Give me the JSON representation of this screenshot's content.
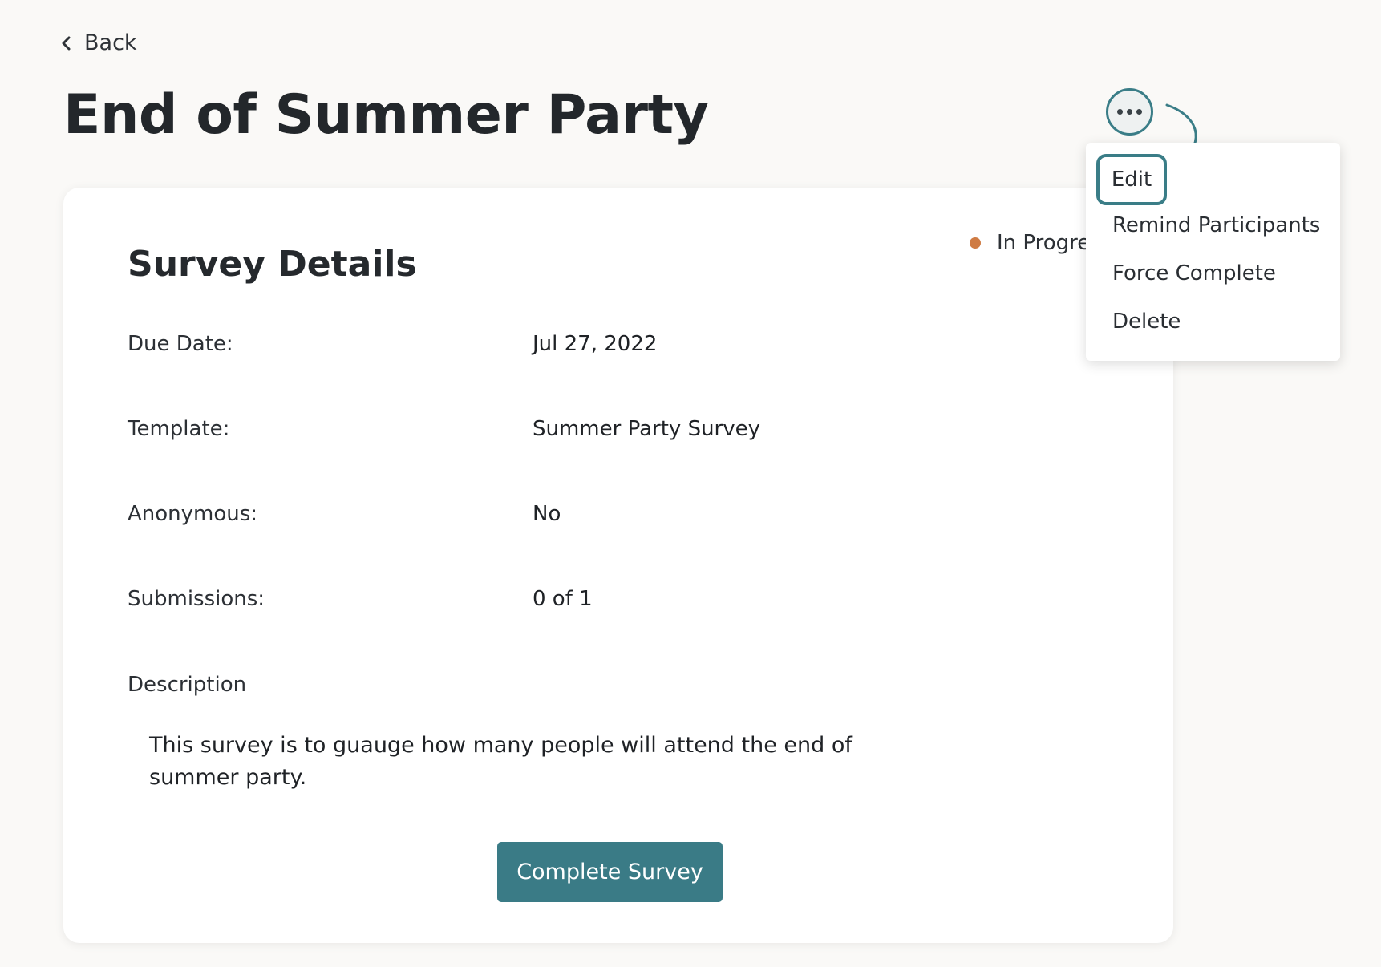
{
  "header": {
    "back_label": "Back",
    "title": "End of Summer Party"
  },
  "more_menu": {
    "button_icon": "more-horizontal-icon",
    "items": [
      "Edit",
      "Remind Participants",
      "Force Complete",
      "Delete"
    ],
    "highlighted_item": "Edit"
  },
  "card": {
    "title": "Survey Details",
    "status": {
      "label": "In Progress",
      "color": "#cf7b43"
    },
    "details": [
      {
        "label": "Due Date:",
        "value": "Jul 27, 2022"
      },
      {
        "label": "Template:",
        "value": "Summer Party Survey"
      },
      {
        "label": "Anonymous:",
        "value": "No"
      },
      {
        "label": "Submissions:",
        "value": "0 of 1"
      }
    ],
    "description_label": "Description",
    "description": "This survey is to guauge how many people will attend the end of summer party.",
    "complete_button": "Complete Survey"
  },
  "colors": {
    "accent": "#3a7b86",
    "background": "#faf9f7",
    "status_in_progress": "#cf7b43"
  }
}
